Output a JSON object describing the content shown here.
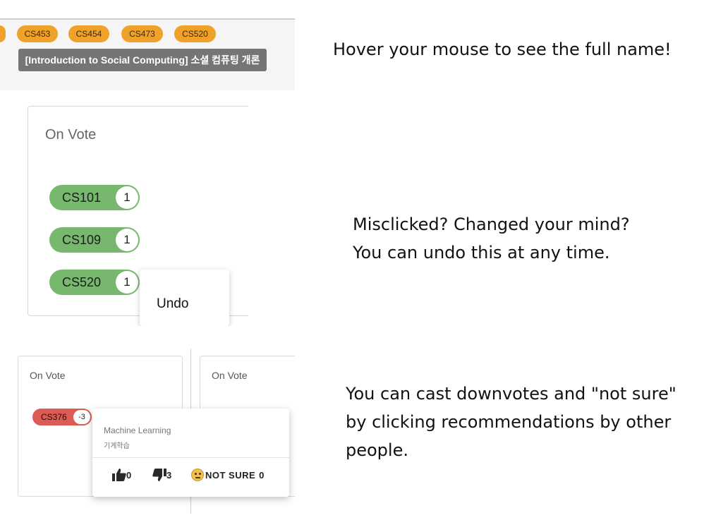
{
  "panel1": {
    "chips": [
      "CS453",
      "CS454",
      "CS473",
      "CS520"
    ],
    "tooltip": "[Introduction to Social Computing] 소셜 컴퓨팅 개론",
    "caption": "Hover your mouse to see the full name!"
  },
  "panel2": {
    "title": "On Vote",
    "chips": [
      {
        "label": "CS101",
        "count": "1"
      },
      {
        "label": "CS109",
        "count": "1"
      },
      {
        "label": "CS520",
        "count": "1"
      }
    ],
    "menu_item": "Undo",
    "caption": "Misclicked? Changed your mind?\nYou can undo this at any time."
  },
  "panel3": {
    "left_title": "On Vote",
    "right_title": "On Vote",
    "chip": {
      "label": "CS376",
      "count": "-3"
    },
    "popover": {
      "name_en": "Machine Learning",
      "name_ko": "기계학습",
      "upvotes": "0",
      "downvotes": "3",
      "not_sure_label": "NOT SURE",
      "not_sure_count": "0"
    },
    "caption": "You can cast downvotes and \"not sure\"\nby clicking recommendations by other\npeople."
  },
  "colors": {
    "chip_orange": "#f0a12a",
    "chip_green": "#77b76e",
    "chip_red": "#dc5b55",
    "tooltip_gray": "#757575"
  },
  "icons": [
    "thumb-up-icon",
    "thumb-down-icon",
    "thinking-face-icon"
  ]
}
